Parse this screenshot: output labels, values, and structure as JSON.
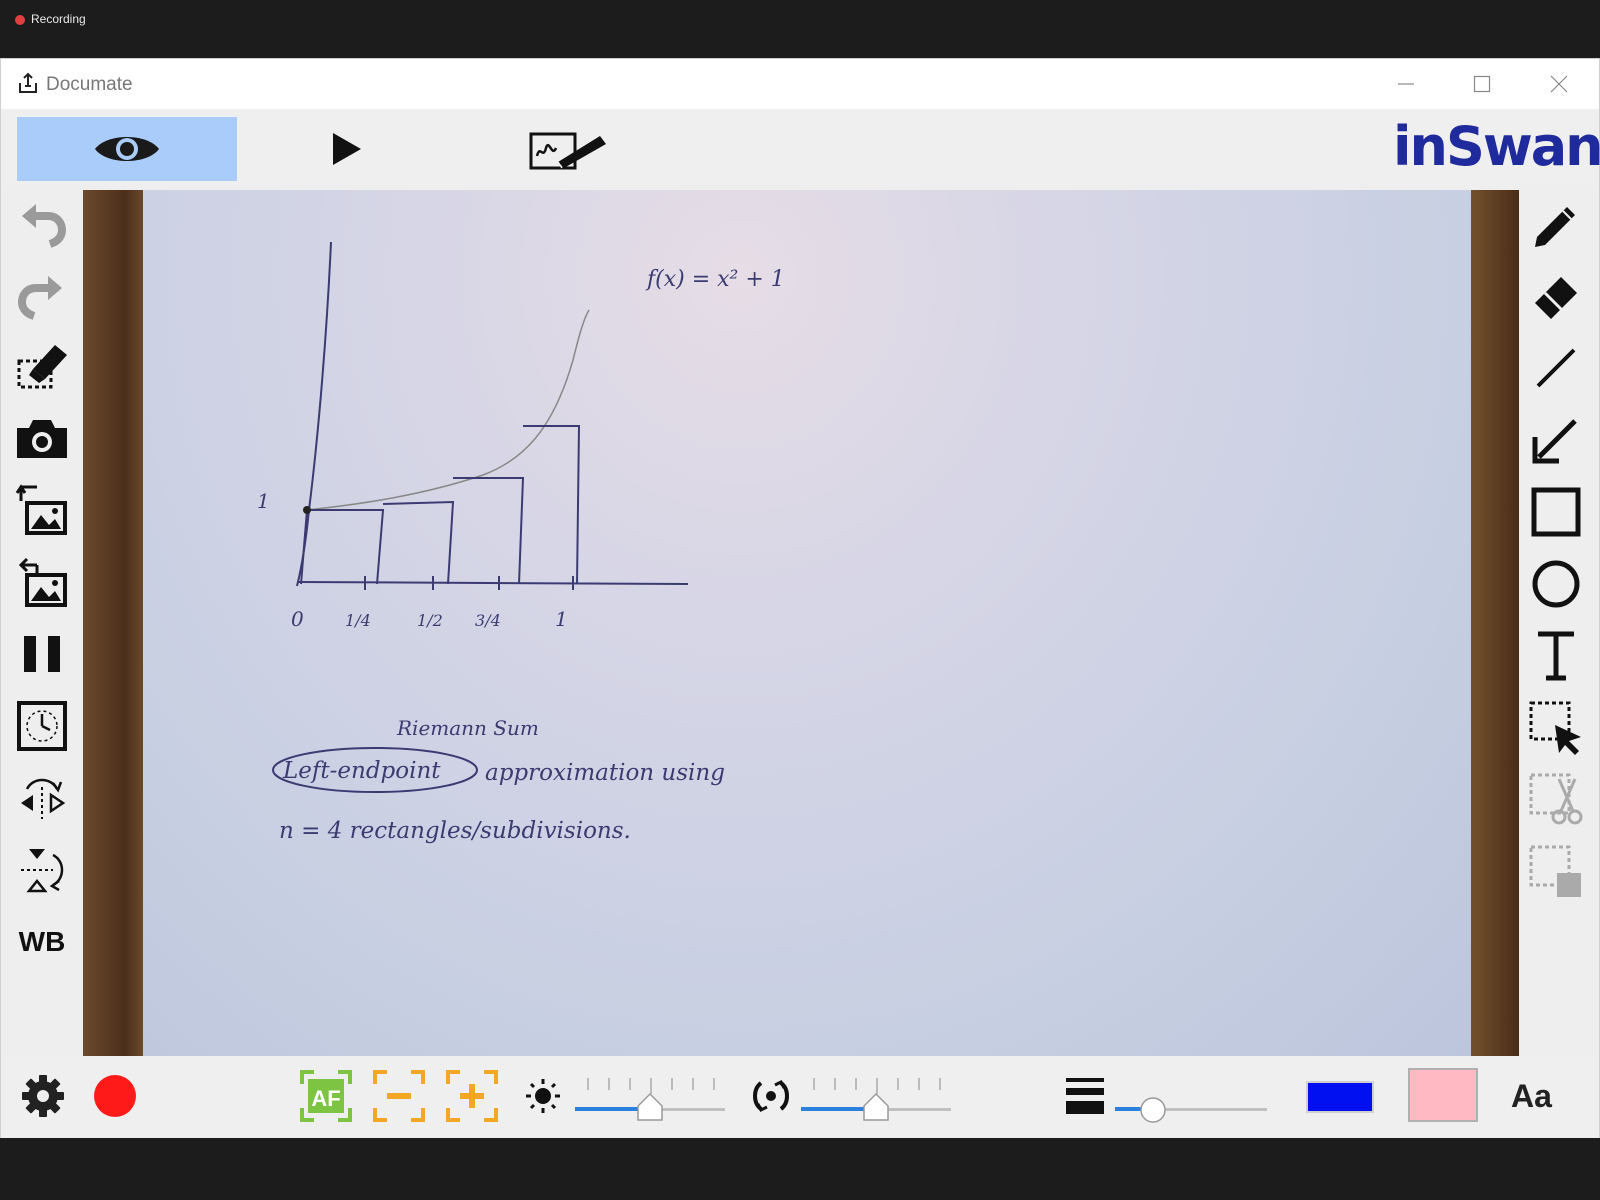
{
  "topbar": {
    "recording_label": "Recording"
  },
  "window": {
    "title": "Documate"
  },
  "brand": {
    "logo_text": "inSwan"
  },
  "toolbar": {
    "modes": [
      "preview-icon",
      "play-icon",
      "annotate-icon"
    ],
    "active_mode": "preview"
  },
  "left_tools": [
    "undo-icon",
    "redo-icon",
    "clear-annotations-icon",
    "camera-icon",
    "import-image-icon",
    "export-image-icon",
    "pause-icon",
    "timer-icon",
    "flip-horizontal-icon",
    "flip-vertical-icon"
  ],
  "left_tools_wb_label": "WB",
  "right_tools": [
    "pen-icon",
    "eraser-icon",
    "line-icon",
    "arrow-icon",
    "rectangle-icon",
    "circle-icon",
    "text-icon",
    "select-icon",
    "cut-icon",
    "paste-icon"
  ],
  "sketch": {
    "formula": "f(x) = x² + 1",
    "y_label": "1",
    "x_ticks": [
      "0",
      "1/4",
      "1/2",
      "3/4",
      "1"
    ],
    "title": "Riemann Sum",
    "line1_circled": "Left-endpoint",
    "line1_rest": "approximation using",
    "line2": "n = 4  rectangles/subdivisions."
  },
  "bottom": {
    "autofocus_label": "AF",
    "brightness_level": 0.5,
    "exposure_level": 0.5,
    "line_width_level": 0.25,
    "stroke_color": "#0010f0",
    "fill_color": "#ffb9c3",
    "font_label": "Aa"
  },
  "colors": {
    "active_mode": "#a9ccfa",
    "brand": "#1f2a9c",
    "record": "#ff1a1a",
    "autofocus": "#7dc443",
    "zoom": "#f5a623",
    "slider": "#2c80e0"
  }
}
